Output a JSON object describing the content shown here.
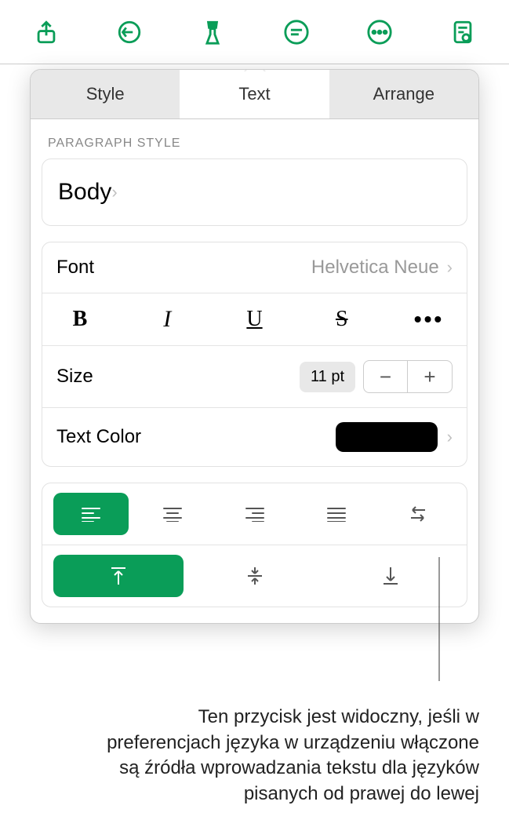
{
  "tabs": {
    "style": "Style",
    "text": "Text",
    "arrange": "Arrange"
  },
  "section_header": "Paragraph Style",
  "paragraph_style": "Body",
  "font": {
    "label": "Font",
    "value": "Helvetica Neue"
  },
  "format_buttons": {
    "bold": "B",
    "italic": "I",
    "underline": "U",
    "strike": "S",
    "more": "•••"
  },
  "size": {
    "label": "Size",
    "value": "11 pt"
  },
  "text_color": {
    "label": "Text Color",
    "value": "#000000"
  },
  "caption": "Ten przycisk jest widoczny, jeśli w preferencjach języka w urządzeniu włączone są źródła wprowadzania tekstu dla języków pisanych od prawej do lewej"
}
